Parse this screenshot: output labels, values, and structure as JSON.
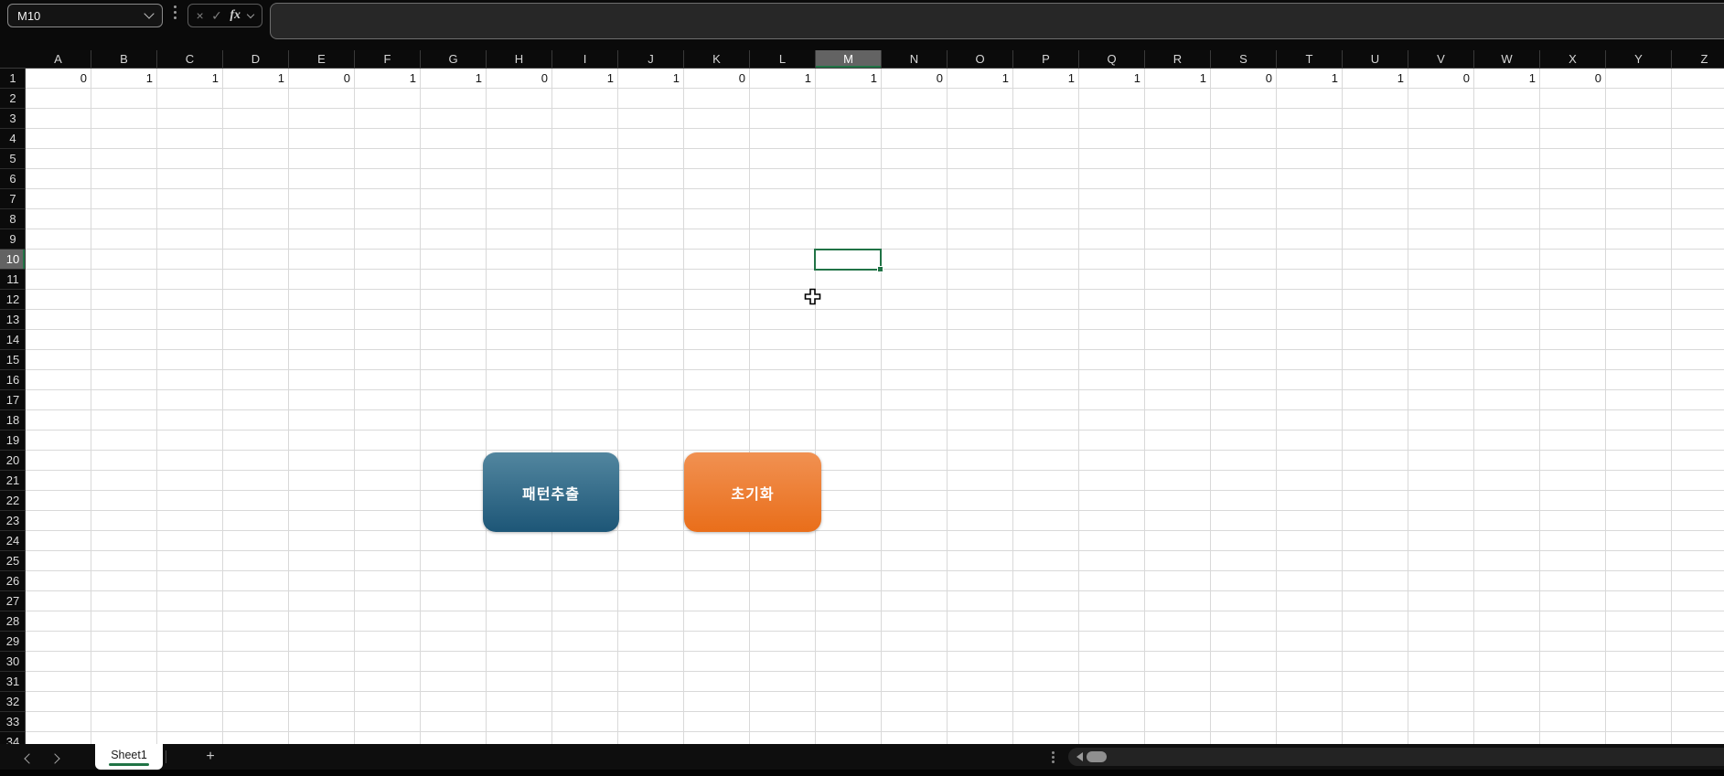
{
  "name_box": {
    "value": "M10"
  },
  "formula_bar": {
    "value": "",
    "cancel_icon": "×",
    "enter_icon": "✓",
    "fx_label": "fx"
  },
  "grid": {
    "columns": [
      "A",
      "B",
      "C",
      "D",
      "E",
      "F",
      "G",
      "H",
      "I",
      "J",
      "K",
      "L",
      "M",
      "N",
      "O",
      "P",
      "Q",
      "R",
      "S",
      "T",
      "U",
      "V",
      "W",
      "X",
      "Y",
      "Z"
    ],
    "row_count": 34,
    "row1_values": [
      0,
      1,
      1,
      1,
      0,
      1,
      1,
      0,
      1,
      1,
      0,
      1,
      1,
      0,
      1,
      1,
      1,
      1,
      0,
      1,
      1,
      0,
      1,
      0,
      null,
      null
    ],
    "selected_cell": {
      "ref": "M10",
      "column": "M",
      "row": 10
    }
  },
  "buttons": [
    {
      "label": "패턴추출",
      "gradient_top": "#52869f",
      "gradient_bottom": "#1d5677"
    },
    {
      "label": "초기화",
      "gradient_top": "#f19152",
      "gradient_bottom": "#e96e1a"
    }
  ],
  "sheet_bar": {
    "tabs": [
      {
        "name": "Sheet1",
        "active": true
      }
    ],
    "add_icon": "+"
  },
  "colors": {
    "selection_green": "#217346",
    "header_highlight": "#636363",
    "grid_line": "#d9d9d9"
  },
  "icons": {
    "name_box_chevron": "chevron-down",
    "formula_group_chevron": "chevron-down",
    "toolbar_handle": "vertical-dots",
    "scrollbar_splitter": "vertical-dots",
    "scroll_left": "left-triangle",
    "prev_sheet": "chevron-left",
    "next_sheet": "chevron-right",
    "cell_cursor": "plus-cross"
  }
}
